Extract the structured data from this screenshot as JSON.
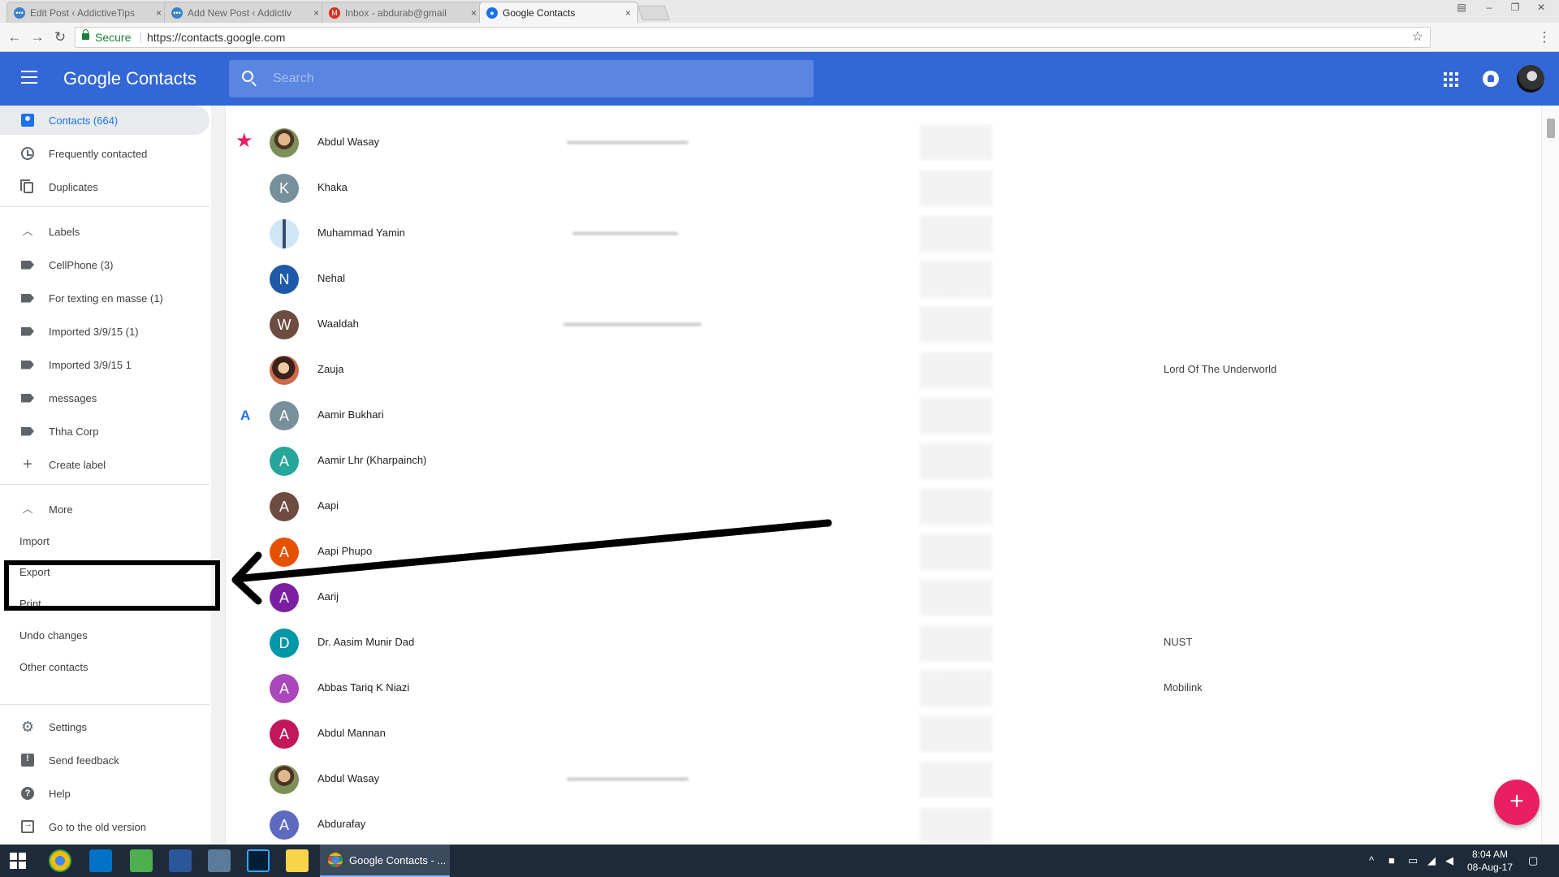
{
  "browser": {
    "tabs": [
      {
        "title": "Edit Post ‹ AddictiveTips",
        "close": "×",
        "fav_color": "#3b83c7"
      },
      {
        "title": "Add New Post ‹ Addictiv",
        "close": "×",
        "fav_color": "#3b83c7"
      },
      {
        "title": "Inbox - abdurab@gmail",
        "close": "×",
        "fav_color": "#d93025"
      },
      {
        "title": "Google Contacts",
        "close": "×",
        "fav_color": "#1a73e8"
      }
    ],
    "secure_label": "Secure",
    "url": "https://contacts.google.com"
  },
  "header": {
    "title": "Google Contacts",
    "search_placeholder": "Search",
    "brand_color": "#3367d6"
  },
  "sidebar": {
    "primary": [
      {
        "label": "Contacts (664)",
        "icon": "contacts-icon"
      },
      {
        "label": "Frequently contacted",
        "icon": "history-icon"
      },
      {
        "label": "Duplicates",
        "icon": "duplicates-icon"
      }
    ],
    "labels_heading": "Labels",
    "labels": [
      {
        "label": "CellPhone (3)"
      },
      {
        "label": "For texting en masse (1)"
      },
      {
        "label": "Imported 3/9/15 (1)"
      },
      {
        "label": "Imported 3/9/15 1"
      },
      {
        "label": "messages"
      },
      {
        "label": "Thha Corp"
      }
    ],
    "create_label": "Create label",
    "more_heading": "More",
    "more": [
      {
        "label": "Import"
      },
      {
        "label": "Export"
      },
      {
        "label": "Print"
      },
      {
        "label": "Undo changes"
      },
      {
        "label": "Other contacts"
      }
    ],
    "footer": [
      {
        "label": "Settings",
        "icon": "gear-icon"
      },
      {
        "label": "Send feedback",
        "icon": "feedback-icon"
      },
      {
        "label": "Help",
        "icon": "help-icon"
      },
      {
        "label": "Go to the old version",
        "icon": "old-version-icon"
      }
    ]
  },
  "contacts": [
    {
      "name": "Abdul Wasay",
      "initial": "",
      "avatar_color": "",
      "photo": "av-photo1",
      "starred": true,
      "section": "",
      "email_blur": 150,
      "job": ""
    },
    {
      "name": "Khaka",
      "initial": "K",
      "avatar_color": "#78909c",
      "photo": "",
      "starred": false,
      "section": "",
      "email_blur": 0,
      "job": ""
    },
    {
      "name": "Muhammad Yamin",
      "initial": "",
      "avatar_color": "",
      "photo": "av-photo2",
      "starred": false,
      "section": "",
      "email_blur": 130,
      "job": ""
    },
    {
      "name": "Nehal",
      "initial": "N",
      "avatar_color": "#1e5aa8",
      "photo": "",
      "starred": false,
      "section": "",
      "email_blur": 0,
      "job": ""
    },
    {
      "name": "Waaldah",
      "initial": "W",
      "avatar_color": "#6d4c41",
      "photo": "",
      "starred": false,
      "section": "",
      "email_blur": 170,
      "job": ""
    },
    {
      "name": "Zauja",
      "initial": "",
      "avatar_color": "",
      "photo": "av-photo3",
      "starred": false,
      "section": "",
      "email_blur": 0,
      "job": "Lord Of The Underworld"
    },
    {
      "name": "Aamir Bukhari",
      "initial": "A",
      "avatar_color": "#78909c",
      "photo": "",
      "starred": false,
      "section": "A",
      "email_blur": 0,
      "job": ""
    },
    {
      "name": "Aamir Lhr (Kharpainch)",
      "initial": "A",
      "avatar_color": "#26a69a",
      "photo": "",
      "starred": false,
      "section": "",
      "email_blur": 0,
      "job": ""
    },
    {
      "name": "Aapi",
      "initial": "A",
      "avatar_color": "#6d4c41",
      "photo": "",
      "starred": false,
      "section": "",
      "email_blur": 0,
      "job": ""
    },
    {
      "name": "Aapi Phupo",
      "initial": "A",
      "avatar_color": "#e65100",
      "photo": "",
      "starred": false,
      "section": "",
      "email_blur": 0,
      "job": ""
    },
    {
      "name": "Aarij",
      "initial": "A",
      "avatar_color": "#7b1fa2",
      "photo": "",
      "starred": false,
      "section": "",
      "email_blur": 0,
      "job": ""
    },
    {
      "name": "Dr. Aasim Munir Dad",
      "initial": "D",
      "avatar_color": "#0097a7",
      "photo": "",
      "starred": false,
      "section": "",
      "email_blur": 0,
      "job": "NUST"
    },
    {
      "name": "Abbas Tariq K Niazi",
      "initial": "A",
      "avatar_color": "#ab47bc",
      "photo": "",
      "starred": false,
      "section": "",
      "email_blur": 0,
      "job": "Mobilink"
    },
    {
      "name": "Abdul Mannan",
      "initial": "A",
      "avatar_color": "#c2185b",
      "photo": "",
      "starred": false,
      "section": "",
      "email_blur": 0,
      "job": ""
    },
    {
      "name": "Abdul Wasay",
      "initial": "",
      "avatar_color": "",
      "photo": "av-photo1",
      "starred": false,
      "section": "",
      "email_blur": 150,
      "job": ""
    },
    {
      "name": "Abdurafay",
      "initial": "A",
      "avatar_color": "#5c6bc0",
      "photo": "",
      "starred": false,
      "section": "",
      "email_blur": 0,
      "job": ""
    }
  ],
  "fab_label": "+",
  "taskbar": {
    "active_window": "Google Contacts - ...",
    "time": "8:04 AM",
    "date": "08-Aug-17"
  }
}
